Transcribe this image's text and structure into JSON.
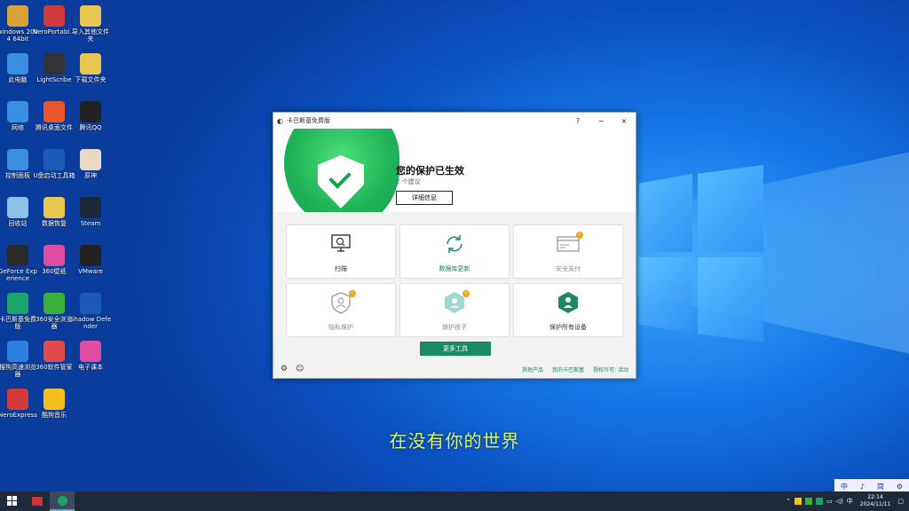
{
  "desktop": {
    "icons": [
      {
        "label": "windows 2004 64bit",
        "color": "#d9a23a"
      },
      {
        "label": "NeroPortabl...",
        "color": "#d23b3b"
      },
      {
        "label": "导入其他文件夹",
        "color": "#e8c650"
      },
      {
        "label": "此电脑",
        "color": "#3a8fe0"
      },
      {
        "label": "LightScribe",
        "color": "#333333"
      },
      {
        "label": "下载文件夹",
        "color": "#e8c650"
      },
      {
        "label": "网络",
        "color": "#3a8fe0"
      },
      {
        "label": "腾讯桌面文件",
        "color": "#e8572a"
      },
      {
        "label": "腾讯QQ",
        "color": "#222222"
      },
      {
        "label": "控制面板",
        "color": "#3a8fe0"
      },
      {
        "label": "U盘启动工具箱",
        "color": "#1c5ab8"
      },
      {
        "label": "原神",
        "color": "#e9d9c0"
      },
      {
        "label": "回收站",
        "color": "#8fc0e8"
      },
      {
        "label": "数据恢复",
        "color": "#e8c650"
      },
      {
        "label": "Steam",
        "color": "#1b2838"
      },
      {
        "label": "GeForce Experience",
        "color": "#2a2a2a"
      },
      {
        "label": "360壁纸",
        "color": "#e04ca0"
      },
      {
        "label": "VMware",
        "color": "#222222"
      },
      {
        "label": "卡巴斯基免费版",
        "color": "#1aa36a"
      },
      {
        "label": "360安全浏览器",
        "color": "#3ab03a"
      },
      {
        "label": "Shadow Defender",
        "color": "#1c5ab8"
      },
      {
        "label": "搜狗高速浏览器",
        "color": "#2e7de0"
      },
      {
        "label": "360软件管家",
        "color": "#e04c4c"
      },
      {
        "label": "电子课本",
        "color": "#e04ca0"
      },
      {
        "label": "NeroExpress",
        "color": "#d23b3b"
      },
      {
        "label": "酷狗音乐",
        "color": "#f3c01e"
      }
    ]
  },
  "kaspersky": {
    "title": "卡巴斯基免费版",
    "controls": {
      "help": "?",
      "minimize": "−",
      "close": "×"
    },
    "status_title": "您的保护已生效",
    "status_sub": "2 个建议",
    "details_button": "详细信息",
    "cards": [
      {
        "label": "扫描",
        "icon": "monitor-scan-icon",
        "badge": ""
      },
      {
        "label": "数据库更新",
        "icon": "sync-icon",
        "badge": ""
      },
      {
        "label": "安全支付",
        "icon": "card-window-icon",
        "badge": "!"
      },
      {
        "label": "隐私保护",
        "icon": "privacy-shield-icon",
        "badge": "!"
      },
      {
        "label": "保护孩子",
        "icon": "child-shield-icon",
        "badge": "!"
      },
      {
        "label": "保护所有设备",
        "icon": "all-devices-icon",
        "badge": ""
      }
    ],
    "more_tools": "更多工具",
    "footer_links": [
      "其他产品",
      "我的卡巴斯基",
      "授权许可: 活动"
    ]
  },
  "subtitle": "在没有你的世界",
  "ime": [
    "中",
    "♪",
    "简",
    "⚙"
  ],
  "tray": {
    "lang": "中",
    "time": "22:14",
    "date": "2024/11/11"
  },
  "colors": {
    "accent": "#1a8a66",
    "status_green": "#20b358",
    "badge": "#f3a31e"
  }
}
